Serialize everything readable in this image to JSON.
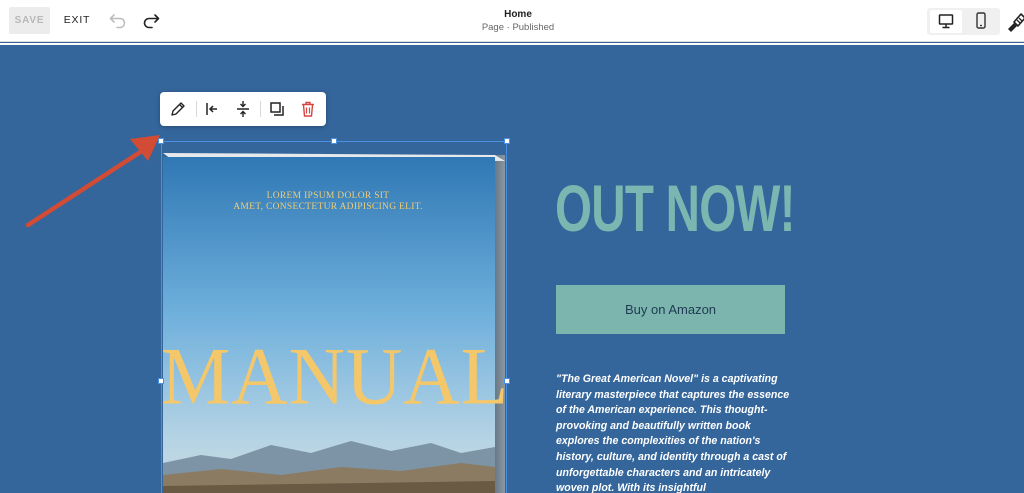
{
  "topbar": {
    "save_label": "SAVE",
    "exit_label": "EXIT",
    "page_title": "Home",
    "page_status": "Page · Published"
  },
  "icons": {
    "undo": "undo-icon",
    "redo": "redo-icon",
    "desktop": "desktop-icon",
    "mobile": "mobile-icon",
    "brush": "paintbrush-icon",
    "edit": "pencil-icon",
    "align_left": "align-left-icon",
    "fit": "vertical-fit-icon",
    "duplicate": "duplicate-icon",
    "delete": "trash-icon"
  },
  "book": {
    "tagline_line1": "LOREM IPSUM DOLOR SIT",
    "tagline_line2": "AMET, CONSECTETUR ADIPISCING ELIT.",
    "title": "MANUAL"
  },
  "main": {
    "headline": "OUT NOW!",
    "buy_label": "Buy on Amazon",
    "description": "\"The Great American Novel\" is a captivating literary masterpiece that captures the essence of the American experience. This thought-provoking and beautifully written book explores the complexities of the nation's history, culture, and identity through a cast of unforgettable characters and an intricately woven plot. With its insightful"
  },
  "colors": {
    "background": "#34659b",
    "accent": "#7bb5ad",
    "selection": "#4a90e2",
    "delete": "#d64541",
    "annotation": "#d24b34"
  }
}
